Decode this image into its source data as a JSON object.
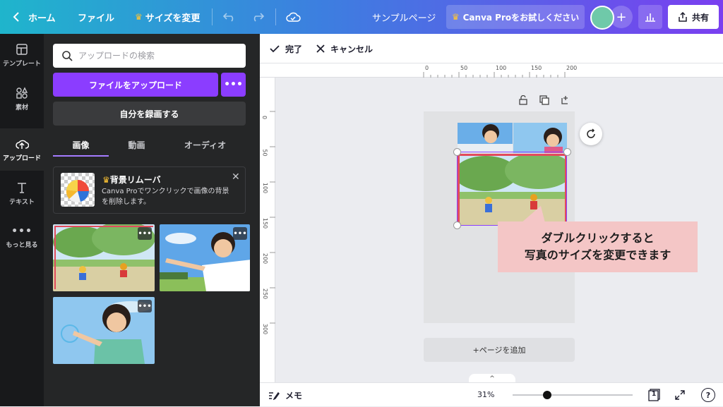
{
  "topbar": {
    "home_label": "ホーム",
    "file_label": "ファイル",
    "resize_label": "サイズを変更",
    "doc_title": "サンプルページ",
    "pro_label": "Canva Proをお試しください",
    "share_label": "共有"
  },
  "sidebar": {
    "items": [
      {
        "label": "テンプレート",
        "icon": "template-icon"
      },
      {
        "label": "素材",
        "icon": "elements-icon"
      },
      {
        "label": "アップロード",
        "icon": "upload-cloud-icon",
        "active": true
      },
      {
        "label": "テキスト",
        "icon": "text-icon"
      },
      {
        "label": "もっと見る",
        "icon": "more-icon"
      }
    ]
  },
  "panel": {
    "search_placeholder": "アップロードの検索",
    "upload_button": "ファイルをアップロード",
    "more_button": "•••",
    "record_button": "自分を録画する",
    "tabs": [
      {
        "label": "画像",
        "active": true
      },
      {
        "label": "動画"
      },
      {
        "label": "オーディオ"
      }
    ],
    "promo": {
      "title": "背景リムーバ",
      "description": "Canva Proでワンクリックで画像の背景を削除します。"
    },
    "thumb_more": "•••"
  },
  "editor": {
    "done_label": "完了",
    "cancel_label": "キャンセル",
    "ruler_top": [
      "0",
      "50",
      "100",
      "150",
      "200"
    ],
    "ruler_left": [
      "0",
      "50",
      "100",
      "150",
      "200",
      "250",
      "300"
    ],
    "callout_line1": "ダブルクリックすると",
    "callout_line2": "写真のサイズを変更できます",
    "add_page": "+ページを追加"
  },
  "bottombar": {
    "memo_label": "メモ",
    "zoom": "31%",
    "zoom_fraction": 0.29,
    "page_number": "1",
    "help_label": "?"
  },
  "colors": {
    "accent": "#8b3dff",
    "topbar_start": "#1fb5cc",
    "topbar_end": "#7a3ff0",
    "panel_bg": "#252627",
    "callout_bg": "#f4c6c6"
  }
}
